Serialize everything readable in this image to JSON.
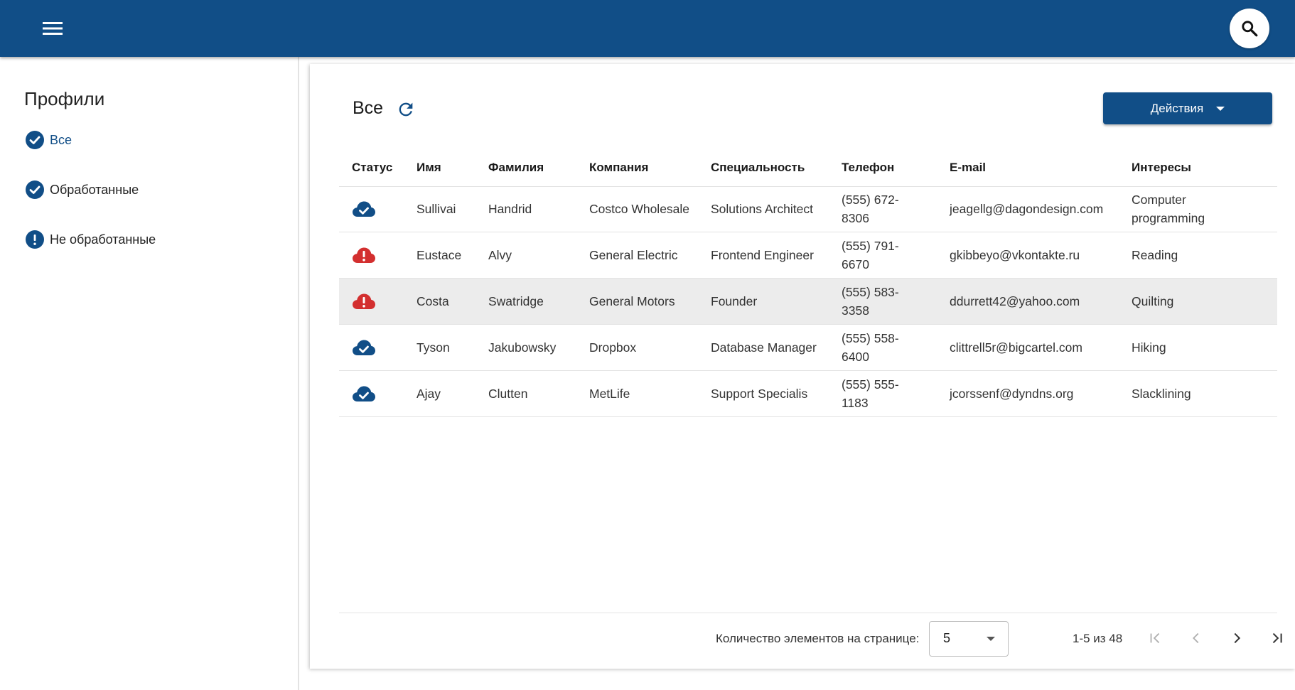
{
  "header": {
    "menu_icon": "hamburger-menu-icon",
    "search_icon": "search-icon",
    "bar_color": "#114e87"
  },
  "sidebar": {
    "title": "Профили",
    "items": [
      {
        "label": "Все",
        "icon": "check-circle-icon",
        "active": true
      },
      {
        "label": "Обработанные",
        "icon": "check-circle-icon",
        "active": false
      },
      {
        "label": "Не обработанные",
        "icon": "exclamation-circle-icon",
        "active": false
      }
    ]
  },
  "main": {
    "title": "Все",
    "refresh_icon": "refresh-icon",
    "actions_label": "Действия",
    "columns": [
      "Статус",
      "Имя",
      "Фамилия",
      "Компания",
      "Специальность",
      "Телефон",
      "E-mail",
      "Интересы"
    ],
    "rows": [
      {
        "status": "synced",
        "first": "Sullivai",
        "last": "Handrid",
        "company": "Costco Wholesale",
        "specialty": "Solutions Architect",
        "phone": "(555) 672-8306",
        "email": "jeagellg@dagondesign.com",
        "interests": "Computer programming"
      },
      {
        "status": "error",
        "first": "Eustace",
        "last": "Alvy",
        "company": "General Electric",
        "specialty": "Frontend Engineer",
        "phone": "(555) 791-6670",
        "email": "gkibbeyo@vkontakte.ru",
        "interests": "Reading"
      },
      {
        "status": "error",
        "first": "Costa",
        "last": "Swatridge",
        "company": "General Motors",
        "specialty": "Founder",
        "phone": "(555) 583-3358",
        "email": "ddurrett42@yahoo.com",
        "interests": "Quilting"
      },
      {
        "status": "synced",
        "first": "Tyson",
        "last": "Jakubowsky",
        "company": "Dropbox",
        "specialty": "Database Manager",
        "phone": "(555) 558-6400",
        "email": "clittrell5r@bigcartel.com",
        "interests": "Hiking"
      },
      {
        "status": "synced",
        "first": "Ajay",
        "last": "Clutten",
        "company": "MetLife",
        "specialty": "Support Specialis",
        "phone": "(555) 555-1183",
        "email": "jcorssenf@dyndns.org",
        "interests": "Slacklining"
      }
    ],
    "status_icons": {
      "synced": "cloud-check-icon",
      "error": "cloud-alert-icon"
    },
    "colors": {
      "primary": "#114e87",
      "error": "#d32f2f",
      "row_highlight": "#ececec"
    }
  },
  "pagination": {
    "per_page_label": "Количество элементов на странице:",
    "per_page_value": "5",
    "range_label": "1-5 из 48",
    "icons": [
      "first-page-icon",
      "previous-page-icon",
      "next-page-icon",
      "last-page-icon"
    ]
  }
}
